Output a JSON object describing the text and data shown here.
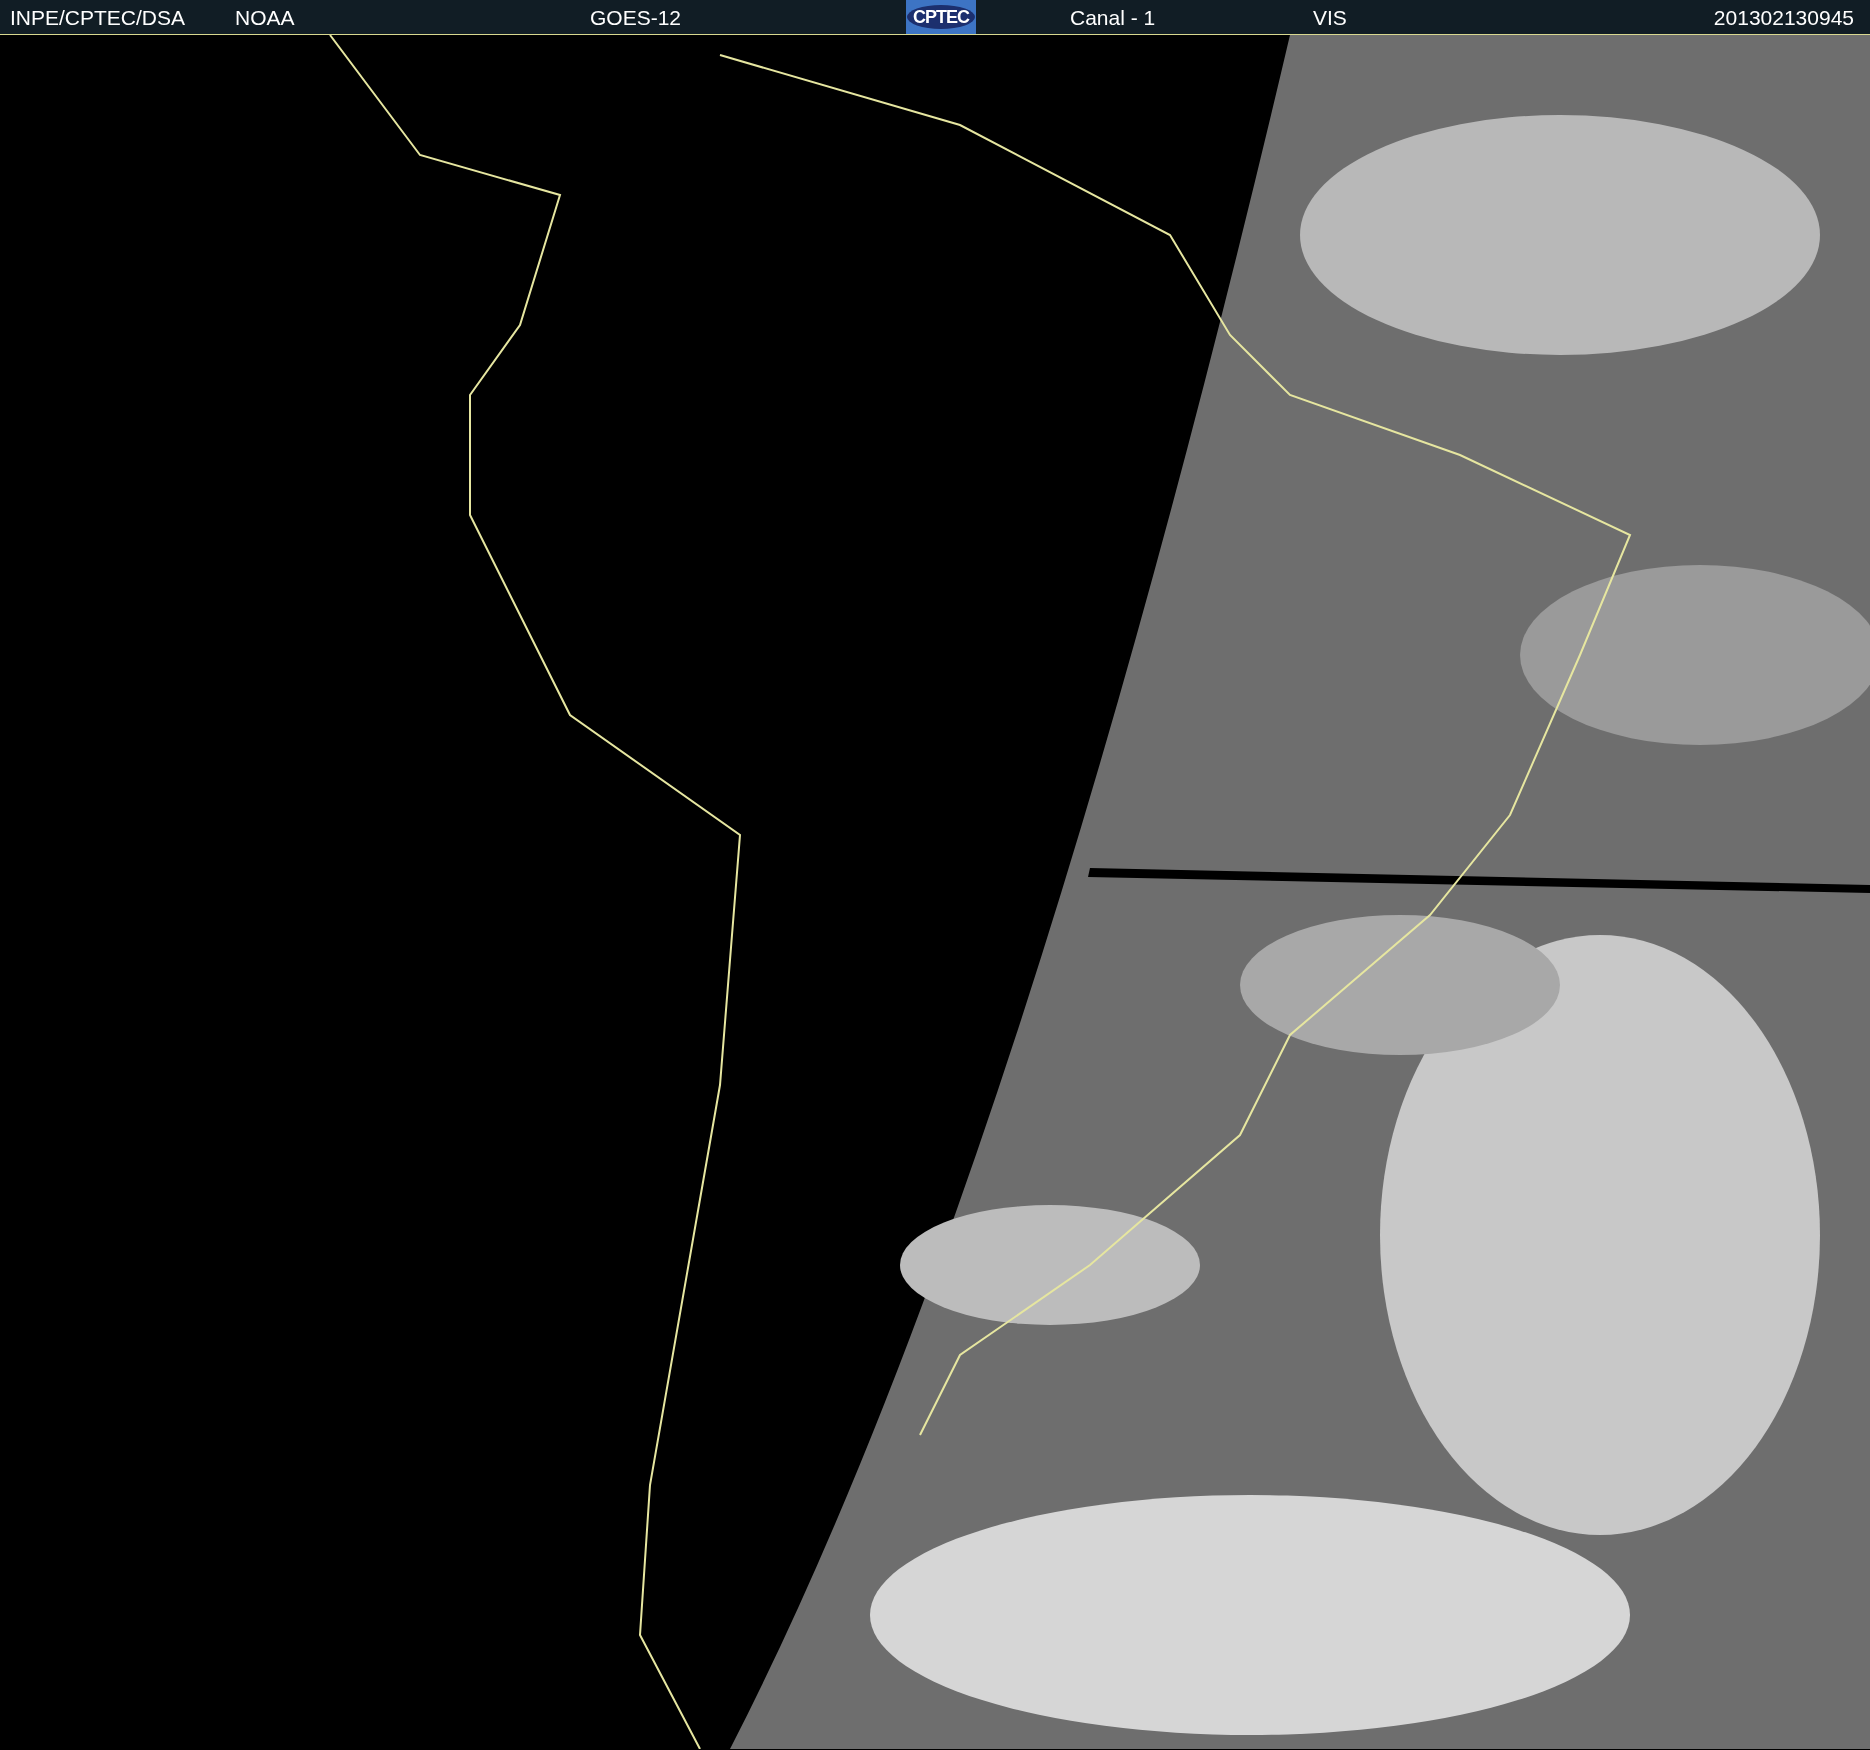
{
  "header": {
    "items": [
      {
        "kind": "text",
        "text": "INPE/CPTEC/DSA"
      },
      {
        "kind": "text",
        "text": "NOAA"
      },
      {
        "kind": "text",
        "text": "GOES-12"
      },
      {
        "kind": "logo",
        "text": "CPTEC"
      },
      {
        "kind": "text",
        "text": "Canal - 1"
      },
      {
        "kind": "text",
        "text": "VIS"
      },
      {
        "kind": "text",
        "text": "201302130945"
      }
    ]
  }
}
